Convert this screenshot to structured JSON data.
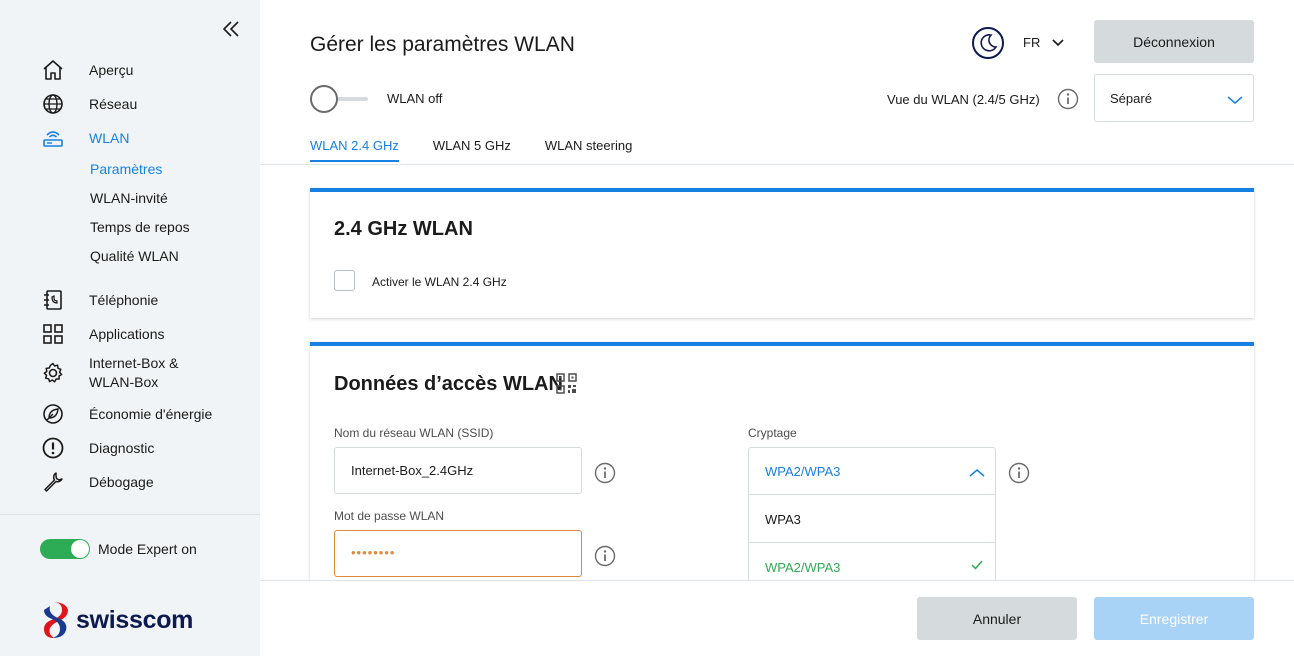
{
  "sidebar": {
    "collapse_icon": "double-chevron-left-icon",
    "items": [
      {
        "label": "Aperçu",
        "icon": "home-icon"
      },
      {
        "label": "Réseau",
        "icon": "globe-icon"
      },
      {
        "label": "WLAN",
        "icon": "router-wifi-icon",
        "active": true
      },
      {
        "label": "Téléphonie",
        "icon": "phone-book-icon"
      },
      {
        "label": "Applications",
        "icon": "apps-grid-icon"
      },
      {
        "label": "Internet-Box &",
        "label2": "WLAN-Box",
        "icon": "gear-icon"
      },
      {
        "label": "Économie d'énergie",
        "icon": "leaf-icon"
      },
      {
        "label": "Diagnostic",
        "icon": "alert-circle-icon"
      },
      {
        "label": "Débogage",
        "icon": "wrench-icon"
      }
    ],
    "wlan_subitems": [
      {
        "label": "Paramètres",
        "active": true
      },
      {
        "label": "WLAN-invité"
      },
      {
        "label": "Temps de repos"
      },
      {
        "label": "Qualité WLAN"
      }
    ],
    "expert_mode": {
      "label": "Mode Expert on",
      "on": true
    },
    "logo_text": "swisscom"
  },
  "header": {
    "title": "Gérer les paramètres WLAN",
    "theme_icon": "moon-icon",
    "language": "FR",
    "logout_label": "Déconnexion",
    "wlan_toggle_label": "WLAN off",
    "view_label": "Vue du WLAN (2.4/5 GHz)",
    "view_select_value": "Séparé"
  },
  "tabs": [
    {
      "label": "WLAN 2.4 GHz",
      "active": true
    },
    {
      "label": "WLAN 5 GHz"
    },
    {
      "label": "WLAN steering"
    }
  ],
  "card1": {
    "title": "2.4 GHz WLAN",
    "checkbox_label": "Activer le WLAN 2.4 GHz",
    "checked": false
  },
  "card2": {
    "title": "Données d’accès WLAN",
    "qr_icon": "qr-code-icon",
    "ssid_label": "Nom du réseau WLAN (SSID)",
    "ssid_value": "Internet-Box_2.4GHz",
    "password_label": "Mot de passe WLAN",
    "password_value": "••••••••",
    "encryption_label": "Cryptage",
    "encryption_value": "WPA2/WPA3",
    "encryption_options": [
      {
        "label": "WPA3"
      },
      {
        "label": "WPA2/WPA3",
        "selected": true
      }
    ]
  },
  "footer": {
    "cancel_label": "Annuler",
    "save_label": "Enregistrer"
  },
  "colors": {
    "accent": "#1781e3",
    "success": "#2eab55",
    "warning": "#e08a3c",
    "sidebar_bg": "#f1f4f6"
  }
}
